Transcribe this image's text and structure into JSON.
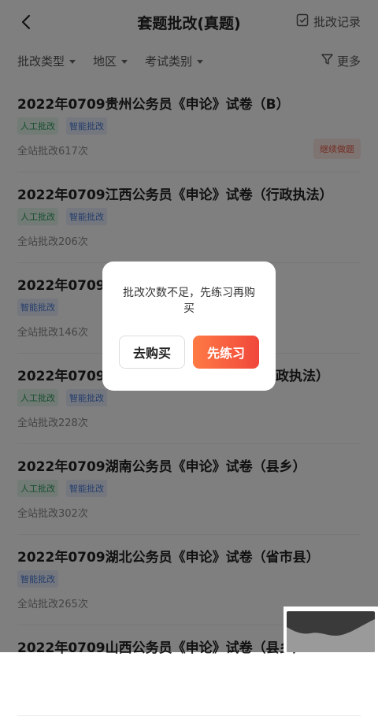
{
  "header": {
    "title": "套题批改(真题)",
    "record_label": "批改记录"
  },
  "filters": {
    "items": [
      "批改类型",
      "地区",
      "考试类别"
    ],
    "more_label": "更多"
  },
  "list": [
    {
      "title": "2022年0709贵州公务员《申论》试卷（B）",
      "tags": [
        "人工批改",
        "智能批改"
      ],
      "count": "全站批改617次",
      "action": "继续做题"
    },
    {
      "title": "2022年0709江西公务员《申论》试卷（行政执法）",
      "tags": [
        "人工批改",
        "智能批改"
      ],
      "count": "全站批改206次"
    },
    {
      "title": "2022年0709重",
      "tags": [
        "智能批改"
      ],
      "count": "全站批改146次"
    },
    {
      "title": "2022年0709黑",
      "title_tail": "政执法）",
      "tags": [
        "人工批改",
        "智能批改"
      ],
      "count": "全站批改228次"
    },
    {
      "title": "2022年0709湖南公务员《申论》试卷（县乡）",
      "tags": [
        "人工批改",
        "智能批改"
      ],
      "count": "全站批改302次"
    },
    {
      "title": "2022年0709湖北公务员《申论》试卷（省市县）",
      "tags": [
        "智能批改"
      ],
      "count": "全站批改265次"
    },
    {
      "title": "2022年0709山西公务员《申论》试卷（县乡）",
      "tags": [],
      "count": ""
    }
  ],
  "dialog": {
    "message": "批改次数不足，先练习再购买",
    "buy_label": "去购买",
    "practice_label": "先练习"
  },
  "colors": {
    "accent": "#f0473b",
    "manual_tag": "#2f9e5f",
    "smart_tag": "#4b7bd9"
  }
}
